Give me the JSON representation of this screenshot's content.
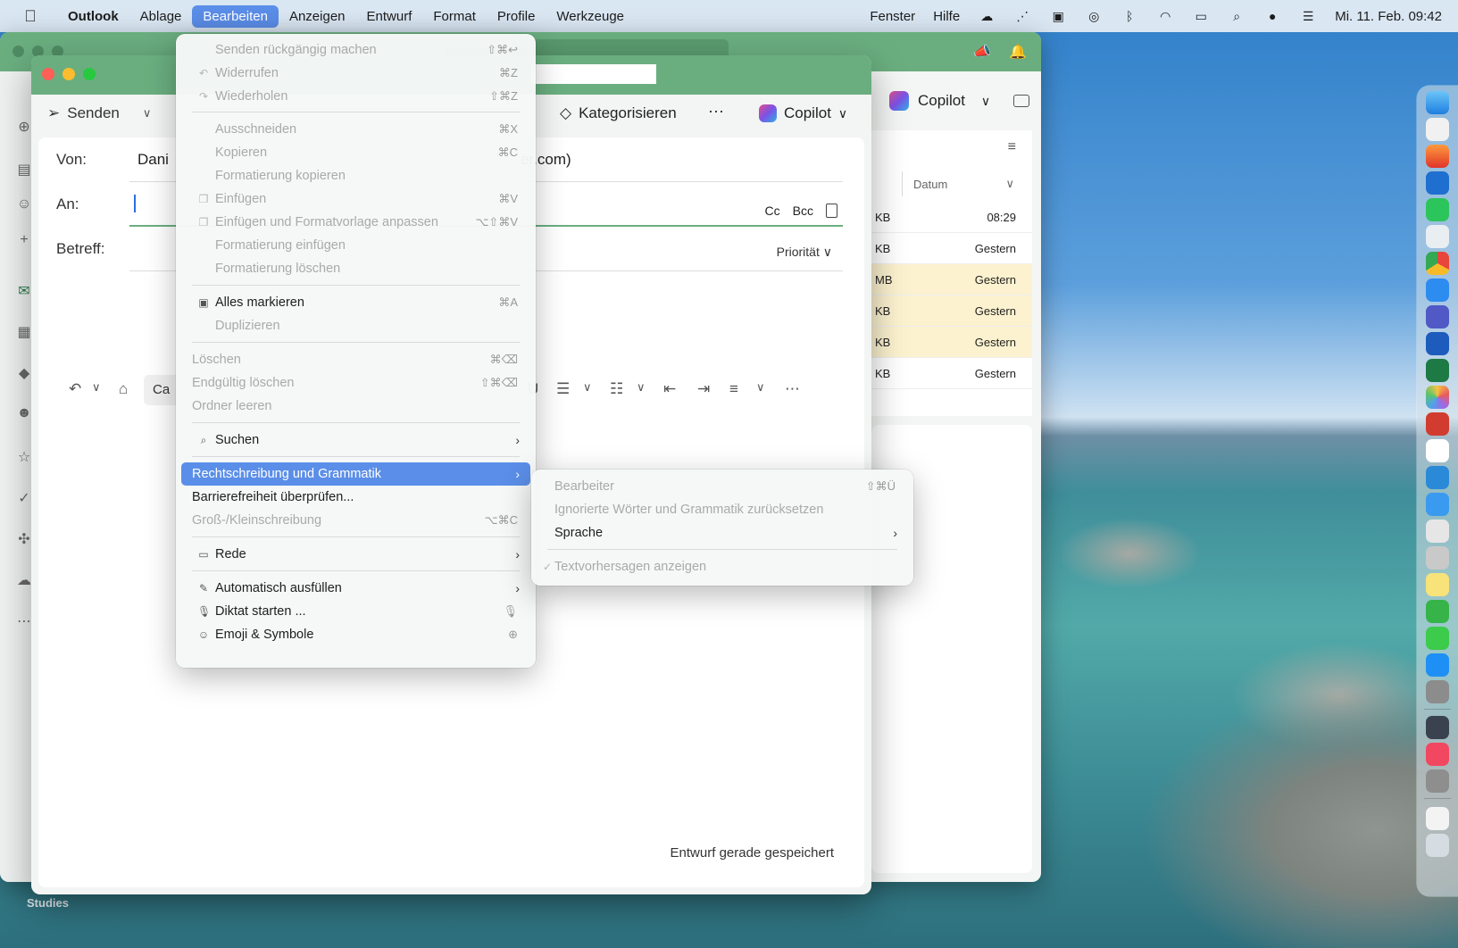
{
  "menubar": {
    "app": "Outlook",
    "items": [
      "Ablage",
      "Bearbeiten",
      "Anzeigen",
      "Entwurf",
      "Format",
      "Profile",
      "Werkzeuge"
    ],
    "right_items": [
      "Fenster",
      "Hilfe"
    ],
    "datetime": "Mi. 11. Feb.  09:42"
  },
  "compose": {
    "send_label": "Senden",
    "categorize_label": "Kategorisieren",
    "more_label": "···",
    "copilot_label": "Copilot",
    "from_label": "Von:",
    "from_value_start": "Dani",
    "from_value_end": "er.com)",
    "to_label": "An:",
    "cc_label": "Cc",
    "bcc_label": "Bcc",
    "subject_label": "Betreff:",
    "priority_label": "Priorität",
    "font_preview": "Ca",
    "saved_status": "Entwurf gerade gespeichert"
  },
  "main_window": {
    "copilot_label": "Copilot",
    "sort_label": "Datum",
    "rows": [
      {
        "size": "KB",
        "date": "08:29"
      },
      {
        "size": "KB",
        "date": "Gestern"
      },
      {
        "size": "MB",
        "date": "Gestern"
      },
      {
        "size": "KB",
        "date": "Gestern"
      },
      {
        "size": "KB",
        "date": "Gestern"
      },
      {
        "size": "KB",
        "date": "Gestern"
      }
    ]
  },
  "edit_menu": {
    "undo_send": "Senden rückgängig machen",
    "undo_send_sc": "⇧⌘↩",
    "undo": "Widerrufen",
    "undo_sc": "⌘Z",
    "redo": "Wiederholen",
    "redo_sc": "⇧⌘Z",
    "cut": "Ausschneiden",
    "cut_sc": "⌘X",
    "copy": "Kopieren",
    "copy_sc": "⌘C",
    "copy_format": "Formatierung kopieren",
    "paste": "Einfügen",
    "paste_sc": "⌘V",
    "paste_match": "Einfügen und Formatvorlage anpassen",
    "paste_match_sc": "⌥⇧⌘V",
    "paste_format": "Formatierung einfügen",
    "clear_format": "Formatierung löschen",
    "select_all": "Alles markieren",
    "select_all_sc": "⌘A",
    "duplicate": "Duplizieren",
    "delete": "Löschen",
    "delete_sc": "⌘⌫",
    "delete_perm": "Endgültig löschen",
    "delete_perm_sc": "⇧⌘⌫",
    "empty_folder": "Ordner leeren",
    "find": "Suchen",
    "spelling": "Rechtschreibung und Grammatik",
    "accessibility": "Barrierefreiheit überprüfen...",
    "case": "Groß-/Kleinschreibung",
    "case_sc": "⌥⌘C",
    "speech": "Rede",
    "autofill": "Automatisch ausfüllen",
    "dictation": "Diktat starten ...",
    "emoji": "Emoji & Symbole"
  },
  "submenu": {
    "editor": "Bearbeiter",
    "editor_sc": "⇧⌘Ü",
    "reset": "Ignorierte Wörter und Grammatik zurücksetzen",
    "language": "Sprache",
    "predictions": "Textvorhersagen anzeigen",
    "predictions_check": "✓"
  },
  "desktop": {
    "folder_label": "Studies"
  },
  "colors": {
    "outlook_green": "#6aae7f",
    "menu_highlight": "#5b8ee8",
    "highlight_row": "#fcf2cf"
  }
}
